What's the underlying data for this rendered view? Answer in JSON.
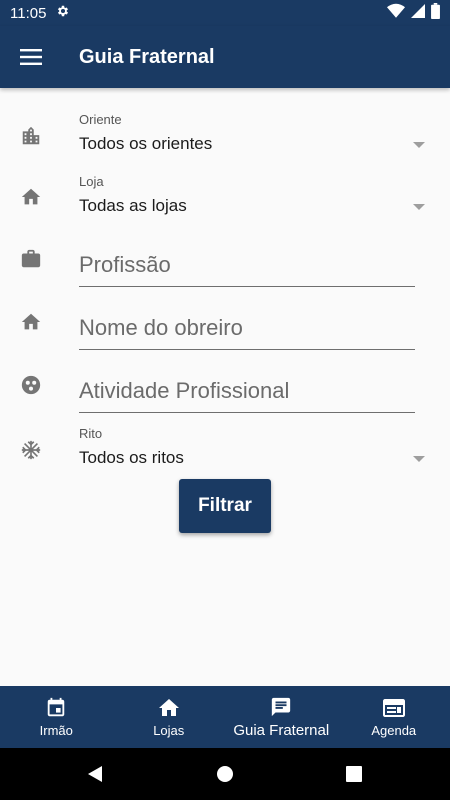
{
  "status": {
    "time": "11:05"
  },
  "app_bar": {
    "title": "Guia Fraternal"
  },
  "filters": {
    "oriente": {
      "label": "Oriente",
      "value": "Todos os orientes"
    },
    "loja": {
      "label": "Loja",
      "value": "Todas as lojas"
    },
    "profissao": {
      "placeholder": "Profissão"
    },
    "obreiro": {
      "placeholder": "Nome do obreiro"
    },
    "atividade": {
      "placeholder": "Atividade Profissional"
    },
    "rito": {
      "label": "Rito",
      "value": "Todos os ritos"
    },
    "filter_button": "Filtrar"
  },
  "bottom_nav": {
    "items": [
      {
        "label": "Irmão",
        "icon": "calendar-icon"
      },
      {
        "label": "Lojas",
        "icon": "home-icon"
      },
      {
        "label": "Guia Fraternal",
        "icon": "chat-icon",
        "active": true
      },
      {
        "label": "Agenda",
        "icon": "agenda-icon"
      }
    ]
  },
  "colors": {
    "primary": "#1a3a63",
    "background": "#fafafa",
    "icon": "#757575"
  }
}
